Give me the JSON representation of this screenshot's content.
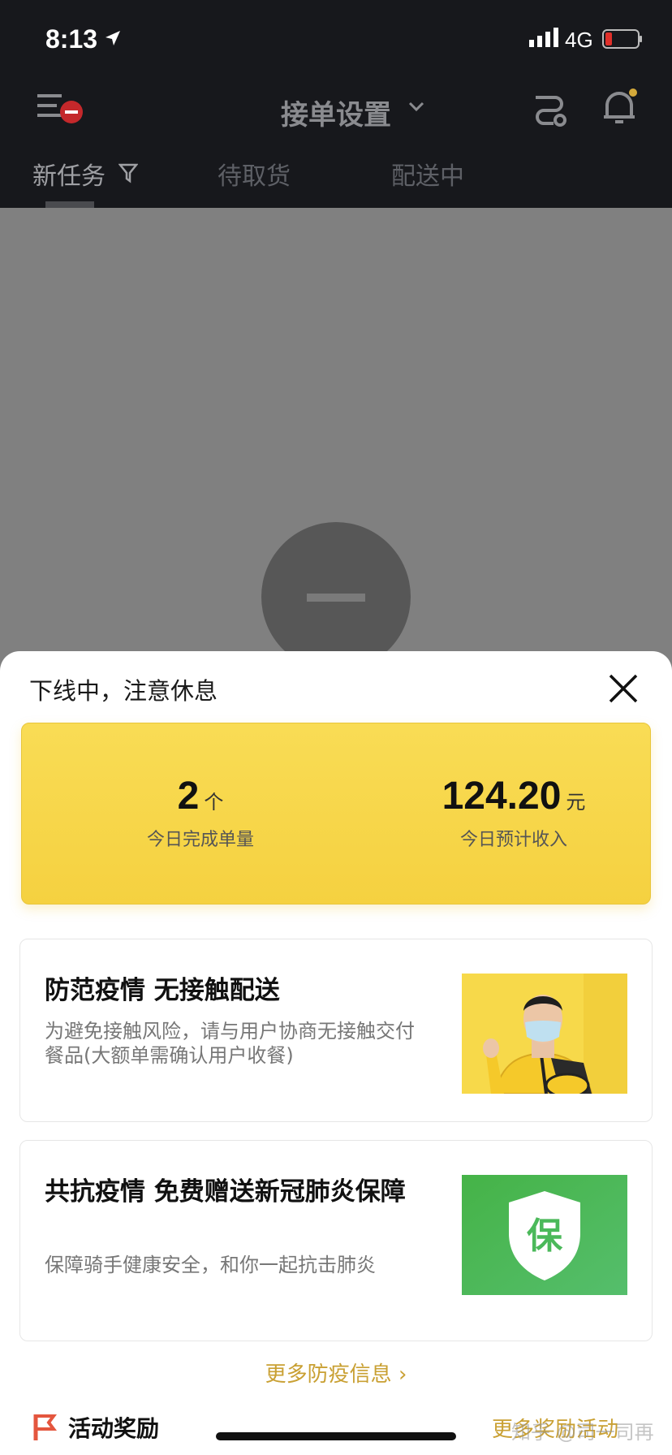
{
  "status_bar": {
    "time": "8:13",
    "network": "4G",
    "icons": [
      "location-arrow-icon",
      "signal-icon",
      "battery-icon"
    ],
    "battery_color": "#e0302a"
  },
  "header": {
    "title": "接单设置",
    "icons": [
      "menu-icon",
      "chevron-down-icon",
      "route-icon",
      "bell-icon"
    ],
    "notification_dot_color": "#d4a93a",
    "offline_badge_color": "#c4282b"
  },
  "tabs": [
    {
      "label": "新任务",
      "active": true
    },
    {
      "label": "待取货",
      "active": false
    },
    {
      "label": "配送中",
      "active": false
    }
  ],
  "sheet": {
    "title": "下线中，注意休息",
    "stats": {
      "orders_value": "2",
      "orders_unit": "个",
      "orders_label": "今日完成单量",
      "income_value": "124.20",
      "income_unit": "元",
      "income_label": "今日预计收入"
    },
    "cards": [
      {
        "title": "防范疫情 无接触配送",
        "desc": "为避免接触风险，请与用户协商无接触交付餐品(大额单需确认用户收餐)",
        "image": "rider-with-mask-photo"
      },
      {
        "title": "共抗疫情 免费赠送新冠肺炎保障",
        "desc": "保障骑手健康安全，和你一起抗击肺炎",
        "image_text": "保"
      }
    ],
    "more_link": "更多防疫信息",
    "activity": {
      "label": "活动奖励",
      "more": "更多奖励活动",
      "watermark": "知乎 @司一司再"
    }
  },
  "colors": {
    "dark_bg": "#17181c",
    "accent_yellow": "#f7d84a",
    "accent_gold_text": "#c9a033",
    "green": "#4bb95a"
  }
}
